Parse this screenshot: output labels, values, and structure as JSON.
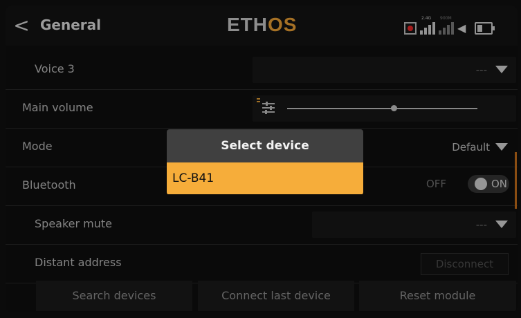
{
  "header": {
    "back_label": "<",
    "title": "General",
    "brand_part1": "ETH",
    "brand_part2": "OS",
    "status_small_1": "2.4G",
    "status_small_2": "900M"
  },
  "rows": {
    "voice3": {
      "label": "Voice 3",
      "value": "---"
    },
    "main_volume": {
      "label": "Main volume"
    },
    "mode": {
      "label": "Mode",
      "value": "Default"
    },
    "bluetooth": {
      "label": "Bluetooth",
      "off_label": "OFF",
      "on_label": "ON",
      "state": "on"
    },
    "speaker_mute": {
      "label": "Speaker mute",
      "value": "---"
    },
    "distant_address": {
      "label": "Distant address",
      "button": "Disconnect"
    }
  },
  "bottom_buttons": {
    "search": "Search devices",
    "connect_last": "Connect last device",
    "reset": "Reset module"
  },
  "dialog": {
    "title": "Select device",
    "items": [
      "LC-B41"
    ]
  },
  "colors": {
    "accent": "#f6ad3a",
    "brand_accent": "#ffae3a",
    "record": "#ff2b2b"
  }
}
